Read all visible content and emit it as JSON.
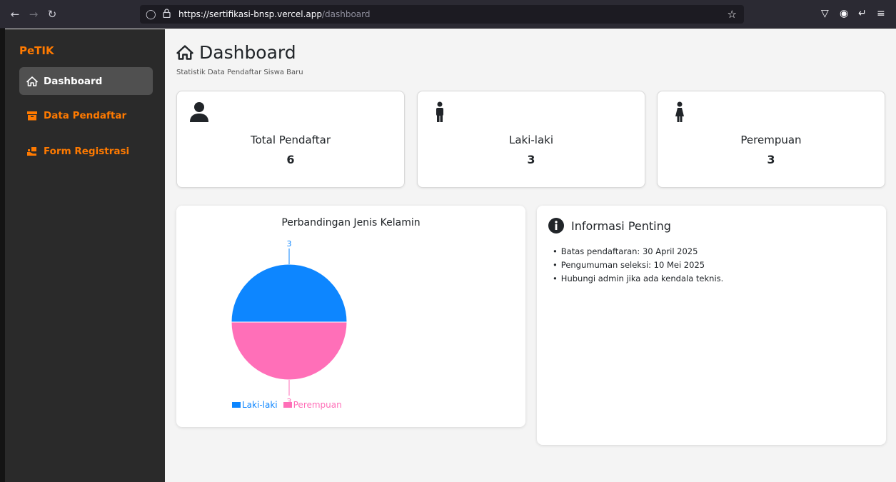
{
  "browser": {
    "url_host": "https://sertifikasi-bnsp.vercel.app",
    "url_path": "/dashboard"
  },
  "sidebar": {
    "brand": "PeTIK",
    "items": [
      {
        "label": "Dashboard",
        "icon": "home-icon",
        "active": true
      },
      {
        "label": "Data Pendaftar",
        "icon": "box-icon",
        "active": false
      },
      {
        "label": "Form Registrasi",
        "icon": "hands-icon",
        "active": false
      }
    ]
  },
  "header": {
    "title": "Dashboard",
    "subtitle": "Statistik Data Pendaftar Siswa Baru"
  },
  "stats": [
    {
      "title": "Total Pendaftar",
      "value": "6",
      "icon": "user-icon"
    },
    {
      "title": "Laki-laki",
      "value": "3",
      "icon": "male-icon"
    },
    {
      "title": "Perempuan",
      "value": "3",
      "icon": "female-icon"
    }
  ],
  "chart_data": {
    "type": "pie",
    "title": "Perbandingan Jenis Kelamin",
    "categories": [
      "Laki-laki",
      "Perempuan"
    ],
    "values": [
      3,
      3
    ],
    "colors": [
      "#0d86ff",
      "#ff6fb8"
    ],
    "legend": "bottom-left"
  },
  "info": {
    "title": "Informasi Penting",
    "items": [
      "Batas pendaftaran: 30 April 2025",
      "Pengumuman seleksi: 10 Mei 2025",
      "Hubungi admin jika ada kendala teknis."
    ]
  },
  "colors": {
    "sidebar_bg": "#2a2a2a",
    "accent": "#ff7a00",
    "active_item": "#505050"
  }
}
